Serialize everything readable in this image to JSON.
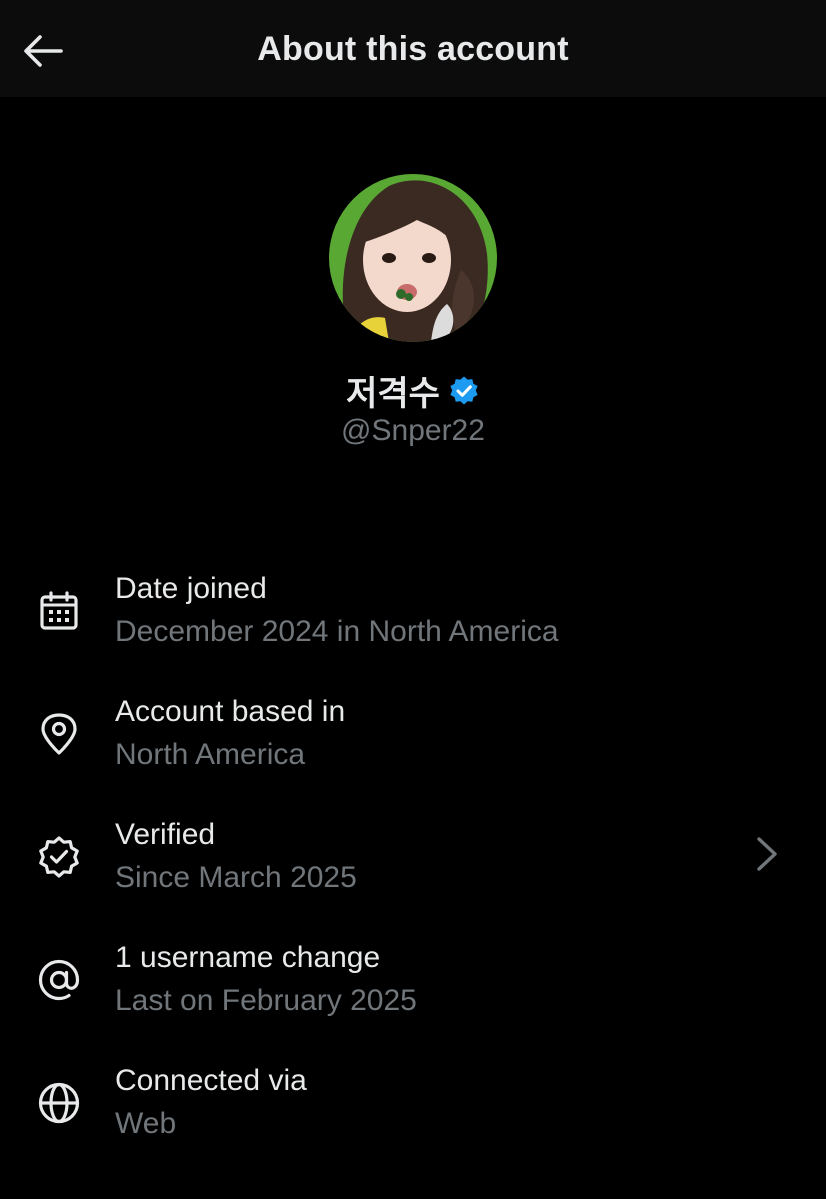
{
  "header": {
    "title": "About this account",
    "back_icon": "arrow-left-icon"
  },
  "profile": {
    "display_name": "저격수",
    "handle": "@Snper22",
    "verified_icon": "verified-badge-icon",
    "verified_color": "#1d9bf0",
    "avatar_background": "#5aa834"
  },
  "info": {
    "items": [
      {
        "icon": "calendar-icon",
        "title": "Date joined",
        "subtitle": "December 2024 in North America"
      },
      {
        "icon": "location-pin-icon",
        "title": "Account based in",
        "subtitle": "North America"
      },
      {
        "icon": "verified-outline-icon",
        "title": "Verified",
        "subtitle": "Since March 2025",
        "has_chevron": true
      },
      {
        "icon": "at-sign-icon",
        "title": "1 username change",
        "subtitle": "Last on February 2025"
      },
      {
        "icon": "globe-icon",
        "title": "Connected via",
        "subtitle": "Web"
      }
    ]
  },
  "colors": {
    "background": "#000000",
    "primary_text": "#e7e9ea",
    "secondary_text": "#71767b"
  }
}
